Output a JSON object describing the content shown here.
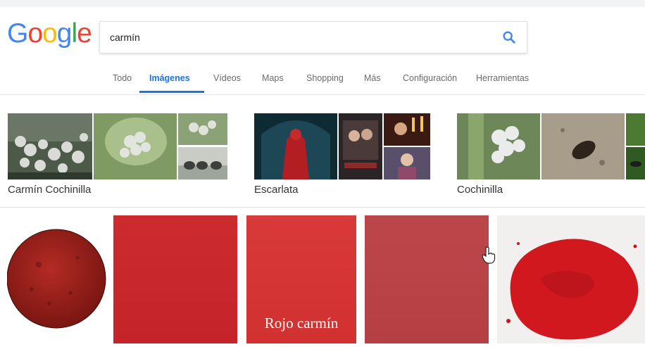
{
  "search": {
    "logo": [
      "G",
      "o",
      "o",
      "g",
      "l",
      "e"
    ],
    "logo_colors": [
      "#4285F4",
      "#EA4335",
      "#FBBC05",
      "#4285F4",
      "#34A853",
      "#EA4335"
    ],
    "query": "carmín",
    "icon": "search-icon"
  },
  "tabs": [
    {
      "label": "Todo",
      "active": false
    },
    {
      "label": "Imágenes",
      "active": true
    },
    {
      "label": "Vídeos",
      "active": false
    },
    {
      "label": "Maps",
      "active": false
    },
    {
      "label": "Shopping",
      "active": false
    },
    {
      "label": "Más",
      "active": false
    },
    {
      "label": "Configuración",
      "active": false
    },
    {
      "label": "Herramientas",
      "active": false
    }
  ],
  "related": [
    {
      "label": "Carmín Cochinilla"
    },
    {
      "label": "Escarlata"
    },
    {
      "label": "Cochinilla"
    }
  ],
  "results": [
    {
      "name": "powder-disc",
      "caption": ""
    },
    {
      "name": "red-swatch",
      "caption": ""
    },
    {
      "name": "rojo-carmin-swatch",
      "caption": "Rojo carmín"
    },
    {
      "name": "muted-red-swatch",
      "caption": ""
    },
    {
      "name": "pigment-pile",
      "caption": ""
    }
  ],
  "colors": {
    "accent": "#1a73e8",
    "carmine": "#c8262b",
    "carmine_light": "#d53535",
    "carmine_muted": "#b84549"
  }
}
